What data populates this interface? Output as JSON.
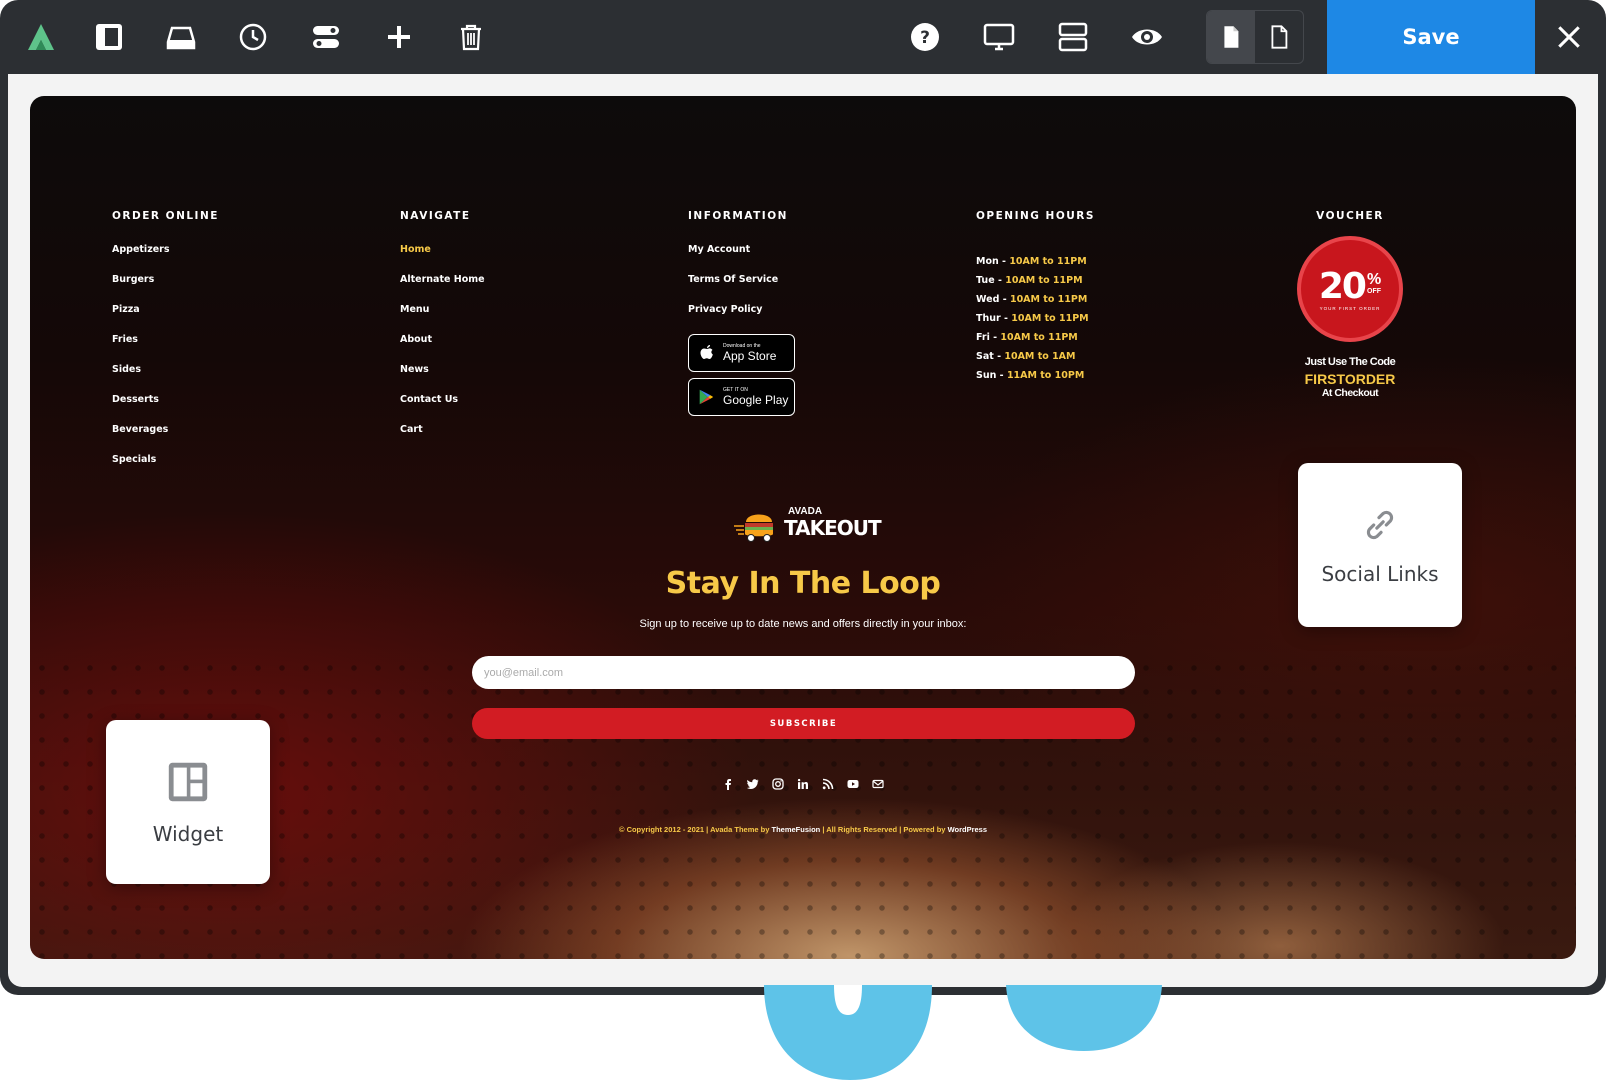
{
  "toolbar": {
    "icons": [
      "avada-logo-icon",
      "sidebar-panel-icon",
      "library-icon",
      "history-icon",
      "toggle-icon",
      "add-icon",
      "trash-icon",
      "help-icon",
      "desktop-icon",
      "layout-sections-icon",
      "preview-eye-icon",
      "page-icon",
      "page-outline-icon",
      "close-icon"
    ],
    "save_label": "Save"
  },
  "footer": {
    "order_online": {
      "heading": "ORDER ONLINE",
      "items": [
        "Appetizers",
        "Burgers",
        "Pizza",
        "Fries",
        "Sides",
        "Desserts",
        "Beverages",
        "Specials"
      ]
    },
    "navigate": {
      "heading": "NAVIGATE",
      "items": [
        "Home",
        "Alternate Home",
        "Menu",
        "About",
        "News",
        "Contact Us",
        "Cart"
      ]
    },
    "information": {
      "heading": "INFORMATION",
      "items": [
        "My Account",
        "Terms Of Service",
        "Privacy Policy"
      ],
      "app_store": {
        "small": "Download on the",
        "big": "App Store"
      },
      "google_play": {
        "small": "GET IT ON",
        "big": "Google Play"
      }
    },
    "opening_hours": {
      "heading": "OPENING HOURS",
      "rows": [
        {
          "day": "Mon",
          "time": "10AM to 11PM"
        },
        {
          "day": "Tue",
          "time": "10AM to 11PM"
        },
        {
          "day": "Wed",
          "time": "10AM to 11PM"
        },
        {
          "day": "Thur",
          "time": "10AM to 11PM"
        },
        {
          "day": "Fri",
          "time": "10AM to 11PM"
        },
        {
          "day": "Sat",
          "time": "10AM to 1AM"
        },
        {
          "day": "Sun",
          "time": "11AM to 10PM"
        }
      ]
    },
    "voucher": {
      "heading": "VOUCHER",
      "percent": "20",
      "pct_sign": "%",
      "off": "OFF",
      "sub": "YOUR FIRST ORDER",
      "line1": "Just Use The Code",
      "code": "FIRSTORDER",
      "line2": "At Checkout"
    },
    "logo": {
      "top": "AVADA",
      "brand": "TAKEOUT"
    },
    "newsletter": {
      "title": "Stay In The Loop",
      "subtitle": "Sign up to receive up to date news and offers directly in your inbox:",
      "placeholder": "you@email.com",
      "button": "SUBSCRIBE"
    },
    "socials": [
      "facebook-icon",
      "twitter-icon",
      "instagram-icon",
      "linkedin-icon",
      "rss-icon",
      "youtube-icon",
      "mail-icon"
    ],
    "copyright": {
      "prefix": "© Copyright 2012 - 2021 | Avada Theme by ",
      "author": "ThemeFusion",
      "mid": " | All Rights Reserved | Powered by ",
      "platform": "WordPress"
    }
  },
  "cards": {
    "social_links": "Social Links",
    "widget": "Widget"
  },
  "colors": {
    "accent_yellow": "#f7c948",
    "subscribe_red": "#d21c23",
    "save_blue": "#1e88e5",
    "toolbar_bg": "#2c2f33"
  }
}
